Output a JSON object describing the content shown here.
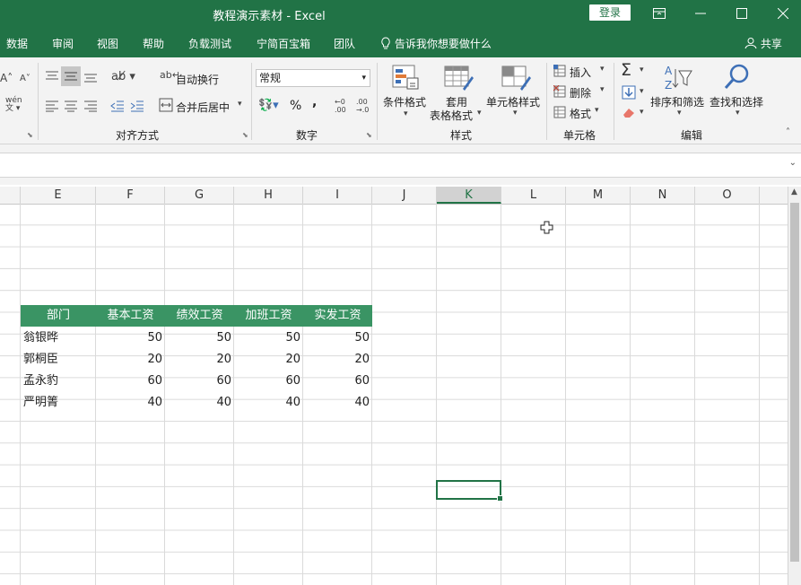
{
  "window": {
    "title": "教程演示素材  -  Excel",
    "login": "登录"
  },
  "tabs": [
    "数据",
    "审阅",
    "视图",
    "帮助",
    "负载测试",
    "宁简百宝箱",
    "团队"
  ],
  "tell_me": "告诉我你想要做什么",
  "share": "共享",
  "ribbon": {
    "wrap_text": "自动换行",
    "merge_center": "合并后居中",
    "number_format": "常规",
    "percent": "%",
    "comma": ",",
    "conditional_format": "条件格式",
    "table_format_1": "套用",
    "table_format_2": "表格格式",
    "cell_styles": "单元格样式",
    "insert": "插入",
    "delete": "删除",
    "format": "格式",
    "sort_filter": "排序和筛选",
    "find_select": "查找和选择",
    "groups": {
      "alignment": "对齐方式",
      "number": "数字",
      "styles": "样式",
      "cells": "单元格",
      "editing": "编辑"
    }
  },
  "columns": [
    "E",
    "F",
    "G",
    "H",
    "I",
    "J",
    "K",
    "L",
    "M",
    "N",
    "O"
  ],
  "table": {
    "headers": [
      "部门",
      "基本工资",
      "绩效工资",
      "加班工资",
      "实发工资"
    ],
    "rows": [
      [
        "翁银晔",
        "50",
        "50",
        "50",
        "50"
      ],
      [
        "郭桐臣",
        "20",
        "20",
        "20",
        "20"
      ],
      [
        "孟永豹",
        "60",
        "60",
        "60",
        "60"
      ],
      [
        "严明箐",
        "40",
        "40",
        "40",
        "40"
      ]
    ]
  },
  "colors": {
    "accent": "#217346",
    "table_header": "#3a9464"
  }
}
